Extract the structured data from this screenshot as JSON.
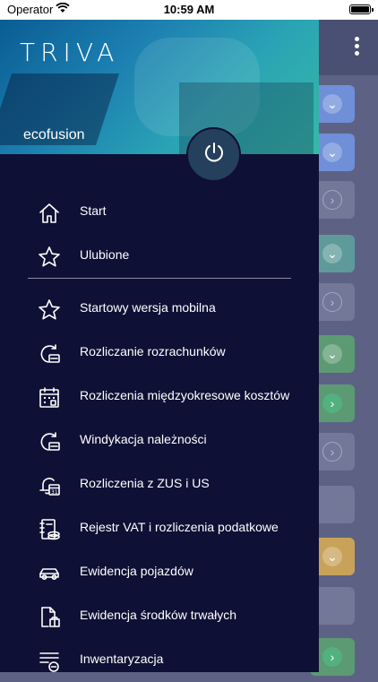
{
  "status_bar": {
    "carrier": "Operator",
    "time": "10:59 AM"
  },
  "drawer": {
    "logo": "TRIVA",
    "company": "ecofusion",
    "top_items": [
      {
        "label": "Start",
        "icon": "home-icon"
      },
      {
        "label": "Ulubione",
        "icon": "star-icon"
      }
    ],
    "items": [
      {
        "label": "Startowy wersja mobilna",
        "icon": "star-icon"
      },
      {
        "label": "Rozliczanie rozrachunków",
        "icon": "settlement-icon"
      },
      {
        "label": "Rozliczenia międzyokresowe kosztów",
        "icon": "calendar-icon"
      },
      {
        "label": "Windykacja należności",
        "icon": "settlement-icon"
      },
      {
        "label": "Rozliczenia z ZUS i US",
        "icon": "bell-calendar-icon"
      },
      {
        "label": "Rejestr VAT i rozliczenia podatkowe",
        "icon": "ledger-icon"
      },
      {
        "label": "Ewidencja pojazdów",
        "icon": "car-icon"
      },
      {
        "label": "Ewidencja środków trwałych",
        "icon": "document-gift-icon"
      },
      {
        "label": "Inwentaryzacja",
        "icon": "list-icon"
      }
    ]
  },
  "background": {
    "cards": [
      {
        "color": "blue",
        "chevron": "down"
      },
      {
        "color": "blue",
        "chevron": "down"
      },
      {
        "color": "gray",
        "chevron": "right"
      },
      {
        "color": "teal",
        "chevron": "down"
      },
      {
        "color": "gray",
        "chevron": "right"
      },
      {
        "color": "green",
        "chevron": "down"
      },
      {
        "color": "green",
        "chevron": "right-solid"
      },
      {
        "color": "gray",
        "chevron": "right"
      },
      {
        "color": "gray",
        "chevron": "none"
      },
      {
        "color": "orange",
        "chevron": "down"
      },
      {
        "color": "gray",
        "chevron": "none"
      },
      {
        "color": "green",
        "chevron": "right-solid"
      }
    ]
  }
}
